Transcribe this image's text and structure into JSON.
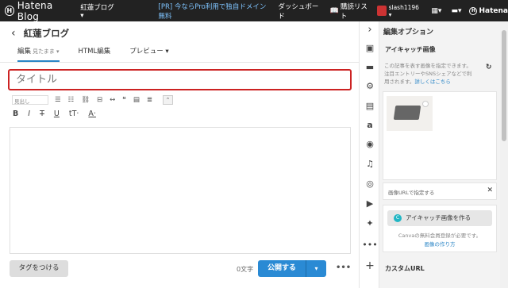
{
  "topbar": {
    "logo_mark": "H",
    "logo_text": "Hatena Blog",
    "blog_menu": "紅蓮ブログ ▾",
    "pr_text": "[PR] 今ならPro利用で独自ドメイン無料",
    "dashboard": "ダッシュボード",
    "reading_list": "購読リスト",
    "username": "slash1196 ▾",
    "hatena": "Hatena"
  },
  "editor": {
    "blog_title": "紅蓮ブログ",
    "tabs": [
      {
        "label": "編集",
        "sub": "見たまま ▾"
      },
      {
        "label": "HTML編集"
      },
      {
        "label": "プレビュー ▾"
      }
    ],
    "title_placeholder": "タイトル",
    "style_select": "見出し",
    "char_count": "0文字",
    "tag_button": "タグをつける",
    "publish_button": "公開する",
    "publish_dropdown": "▾",
    "more": "•••"
  },
  "panel": {
    "header": "編集オプション",
    "eyecatch_title": "アイキャッチ画像",
    "eyecatch_desc": "この記事を表す画像を指定できます。注目エントリーやSNSシェアなどで利用されます。",
    "details_link": "詳しくはこちら",
    "image_url_label": "画像URLで指定する",
    "canva_button": "アイキャッチ画像を作る",
    "canva_note": "Canvaの無料会員登録が必要です。",
    "howto_link": "画像の作り方",
    "custom_url": "カスタムURL"
  },
  "icons": {
    "collapse": "›",
    "items": [
      "photo-icon",
      "folder-icon",
      "gear-icon",
      "document-icon",
      "amazon-icon",
      "rakuten-icon",
      "music-icon",
      "instagram-icon",
      "youtube-icon",
      "twitter-icon",
      "more-icon",
      "plus-icon"
    ]
  },
  "colors": {
    "topbar": "#222222",
    "accent": "#2a8ad4",
    "title_border": "#cc2222",
    "canva": "#21b6c4"
  }
}
